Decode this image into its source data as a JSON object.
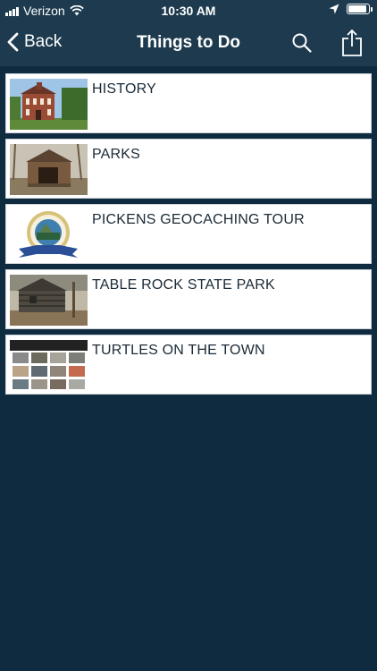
{
  "status": {
    "carrier": "Verizon",
    "time": "10:30 AM",
    "battery_level": 0.9
  },
  "nav": {
    "back_label": "Back",
    "title": "Things to Do",
    "icons": [
      "chevron-left-icon",
      "search-icon",
      "share-icon"
    ]
  },
  "items": [
    {
      "label": "HISTORY",
      "thumb": "historic-building-photo"
    },
    {
      "label": "PARKS",
      "thumb": "covered-bridge-photo"
    },
    {
      "label": "PICKENS GEOCACHING TOUR",
      "thumb": "geocaching-tour-seal"
    },
    {
      "label": "TABLE ROCK STATE PARK",
      "thumb": "log-cabin-photo"
    },
    {
      "label": "TURTLES ON THE TOWN",
      "thumb": "turtles-collage"
    }
  ],
  "colors": {
    "background": "#0f2b40",
    "bar": "#1d3a4f",
    "item_bg": "#ffffff",
    "item_text": "#1a2a36"
  }
}
